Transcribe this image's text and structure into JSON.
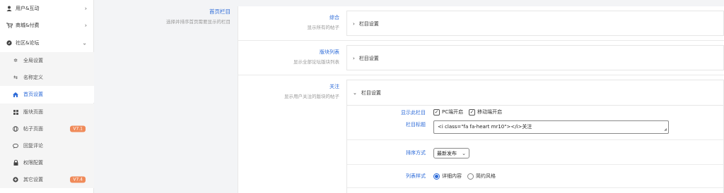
{
  "sidebar": {
    "items": [
      {
        "label": "用户&互动",
        "icon": "user-icon"
      },
      {
        "label": "商城&付费",
        "icon": "cart-icon"
      },
      {
        "label": "社区&论坛",
        "icon": "compass-icon"
      }
    ],
    "sub_items": [
      {
        "label": "全局设置",
        "icon": "settings-icon",
        "badge": ""
      },
      {
        "label": "名称定义",
        "icon": "exchange-icon",
        "badge": ""
      },
      {
        "label": "首页设置",
        "icon": "home-icon",
        "badge": "",
        "active": true
      },
      {
        "label": "版块页面",
        "icon": "windows-icon",
        "badge": ""
      },
      {
        "label": "帖子页面",
        "icon": "globe-icon",
        "badge": "V7.1"
      },
      {
        "label": "回复评论",
        "icon": "comment-icon",
        "badge": ""
      },
      {
        "label": "权限配置",
        "icon": "lock-icon",
        "badge": ""
      },
      {
        "label": "其它设置",
        "icon": "plus-circle-icon",
        "badge": "V7.4"
      }
    ]
  },
  "page": {
    "title": "首页栏目",
    "desc": "选择并排序首页需要显示的栏目"
  },
  "rows": [
    {
      "title": "综合",
      "desc": "显示所有的帖子",
      "box_label": "栏目设置"
    },
    {
      "title": "版块列表",
      "desc": "显示全部论坛版块列表",
      "box_label": "栏目设置"
    },
    {
      "title": "关注",
      "desc": "显示用户关注的版块的帖子",
      "box_label": "栏目设置"
    }
  ],
  "form": {
    "display_label": "显示此栏目",
    "pc_label": "PC端开启",
    "mobile_label": "移动端开启",
    "column_title_label": "栏目标题",
    "column_title_value": "<i class=\"fa fa-heart mr10\"></i>关注",
    "sort_label": "排序方式",
    "sort_value": "最新发布",
    "list_style_label": "列表样式",
    "list_style_options": [
      "详细内容",
      "简约风格"
    ]
  },
  "colors": {
    "accent": "#2d6bd8",
    "badge": "#f08b5a"
  }
}
